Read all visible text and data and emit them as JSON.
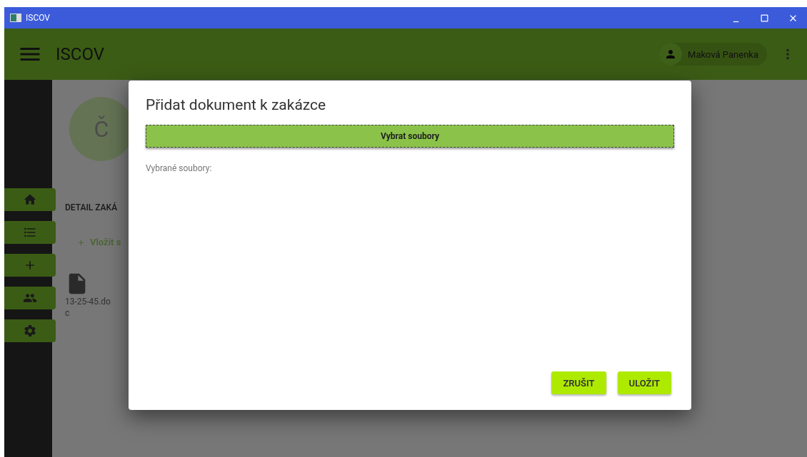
{
  "window": {
    "title": "ISCOV"
  },
  "app_bar": {
    "title": "ISCOV",
    "user": "Maková Panenka"
  },
  "sidebar": {
    "items": [
      {
        "kind": "home"
      },
      {
        "kind": "list"
      },
      {
        "kind": "add"
      },
      {
        "kind": "people"
      },
      {
        "kind": "settings"
      }
    ]
  },
  "content": {
    "avatar": "Č",
    "section_title": "DETAIL ZAKÁ",
    "insert_link": "Vložit s",
    "files": [
      "13-25-45.doc"
    ]
  },
  "dialog": {
    "title": "Přidat dokument k zakázce",
    "select_button": "Vybrat soubory",
    "selected_label": "Vybrané soubory:",
    "buttons": [
      "ZRUŠIT",
      "ULOŽIT"
    ]
  }
}
